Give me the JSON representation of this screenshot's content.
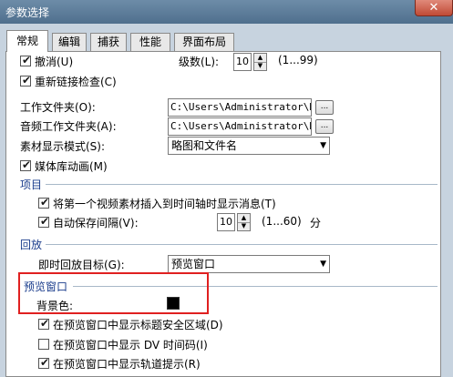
{
  "window": {
    "title": "参数选择",
    "close_glyph": "✕"
  },
  "tabs": [
    {
      "label": "常规",
      "active": true
    },
    {
      "label": "编辑"
    },
    {
      "label": "捕获"
    },
    {
      "label": "性能"
    },
    {
      "label": "界面布局"
    }
  ],
  "general": {
    "undo": {
      "label": "撤消(U)",
      "checked": true
    },
    "levels": {
      "label": "级数(L):",
      "value": "10",
      "range": "(1...99)"
    },
    "relink": {
      "label": "重新链接检查(C)",
      "checked": true
    },
    "work_folder": {
      "label": "工作文件夹(O):",
      "value": "C:\\Users\\Administrator\\Docum",
      "browse": "..."
    },
    "audio_folder": {
      "label": "音频工作文件夹(A):",
      "value": "C:\\Users\\Administrator\\Docum",
      "browse": "..."
    },
    "display_mode": {
      "label": "素材显示模式(S):",
      "value": "略图和文件名"
    },
    "media_anim": {
      "label": "媒体库动画(M)",
      "checked": true
    }
  },
  "project": {
    "title": "项目",
    "insert_msg": {
      "label": "将第一个视频素材插入到时间轴时显示消息(T)",
      "checked": true
    },
    "autosave": {
      "label": "自动保存间隔(V):",
      "checked": true,
      "value": "10",
      "range": "(1...60)",
      "unit": "分"
    }
  },
  "playback": {
    "title": "回放",
    "target": {
      "label": "即时回放目标(G):",
      "value": "预览窗口"
    }
  },
  "preview": {
    "title": "预览窗口",
    "bg_color": {
      "label": "背景色:",
      "color": "#000000"
    },
    "safe_area": {
      "label": "在预览窗口中显示标题安全区域(D)",
      "checked": true
    },
    "dv_timecode": {
      "label": "在预览窗口中显示 DV 时间码(I)",
      "checked": false
    },
    "track_hints": {
      "label": "在预览窗口中显示轨道提示(R)",
      "checked": true
    }
  },
  "annotation": {
    "color": "#e02020"
  }
}
